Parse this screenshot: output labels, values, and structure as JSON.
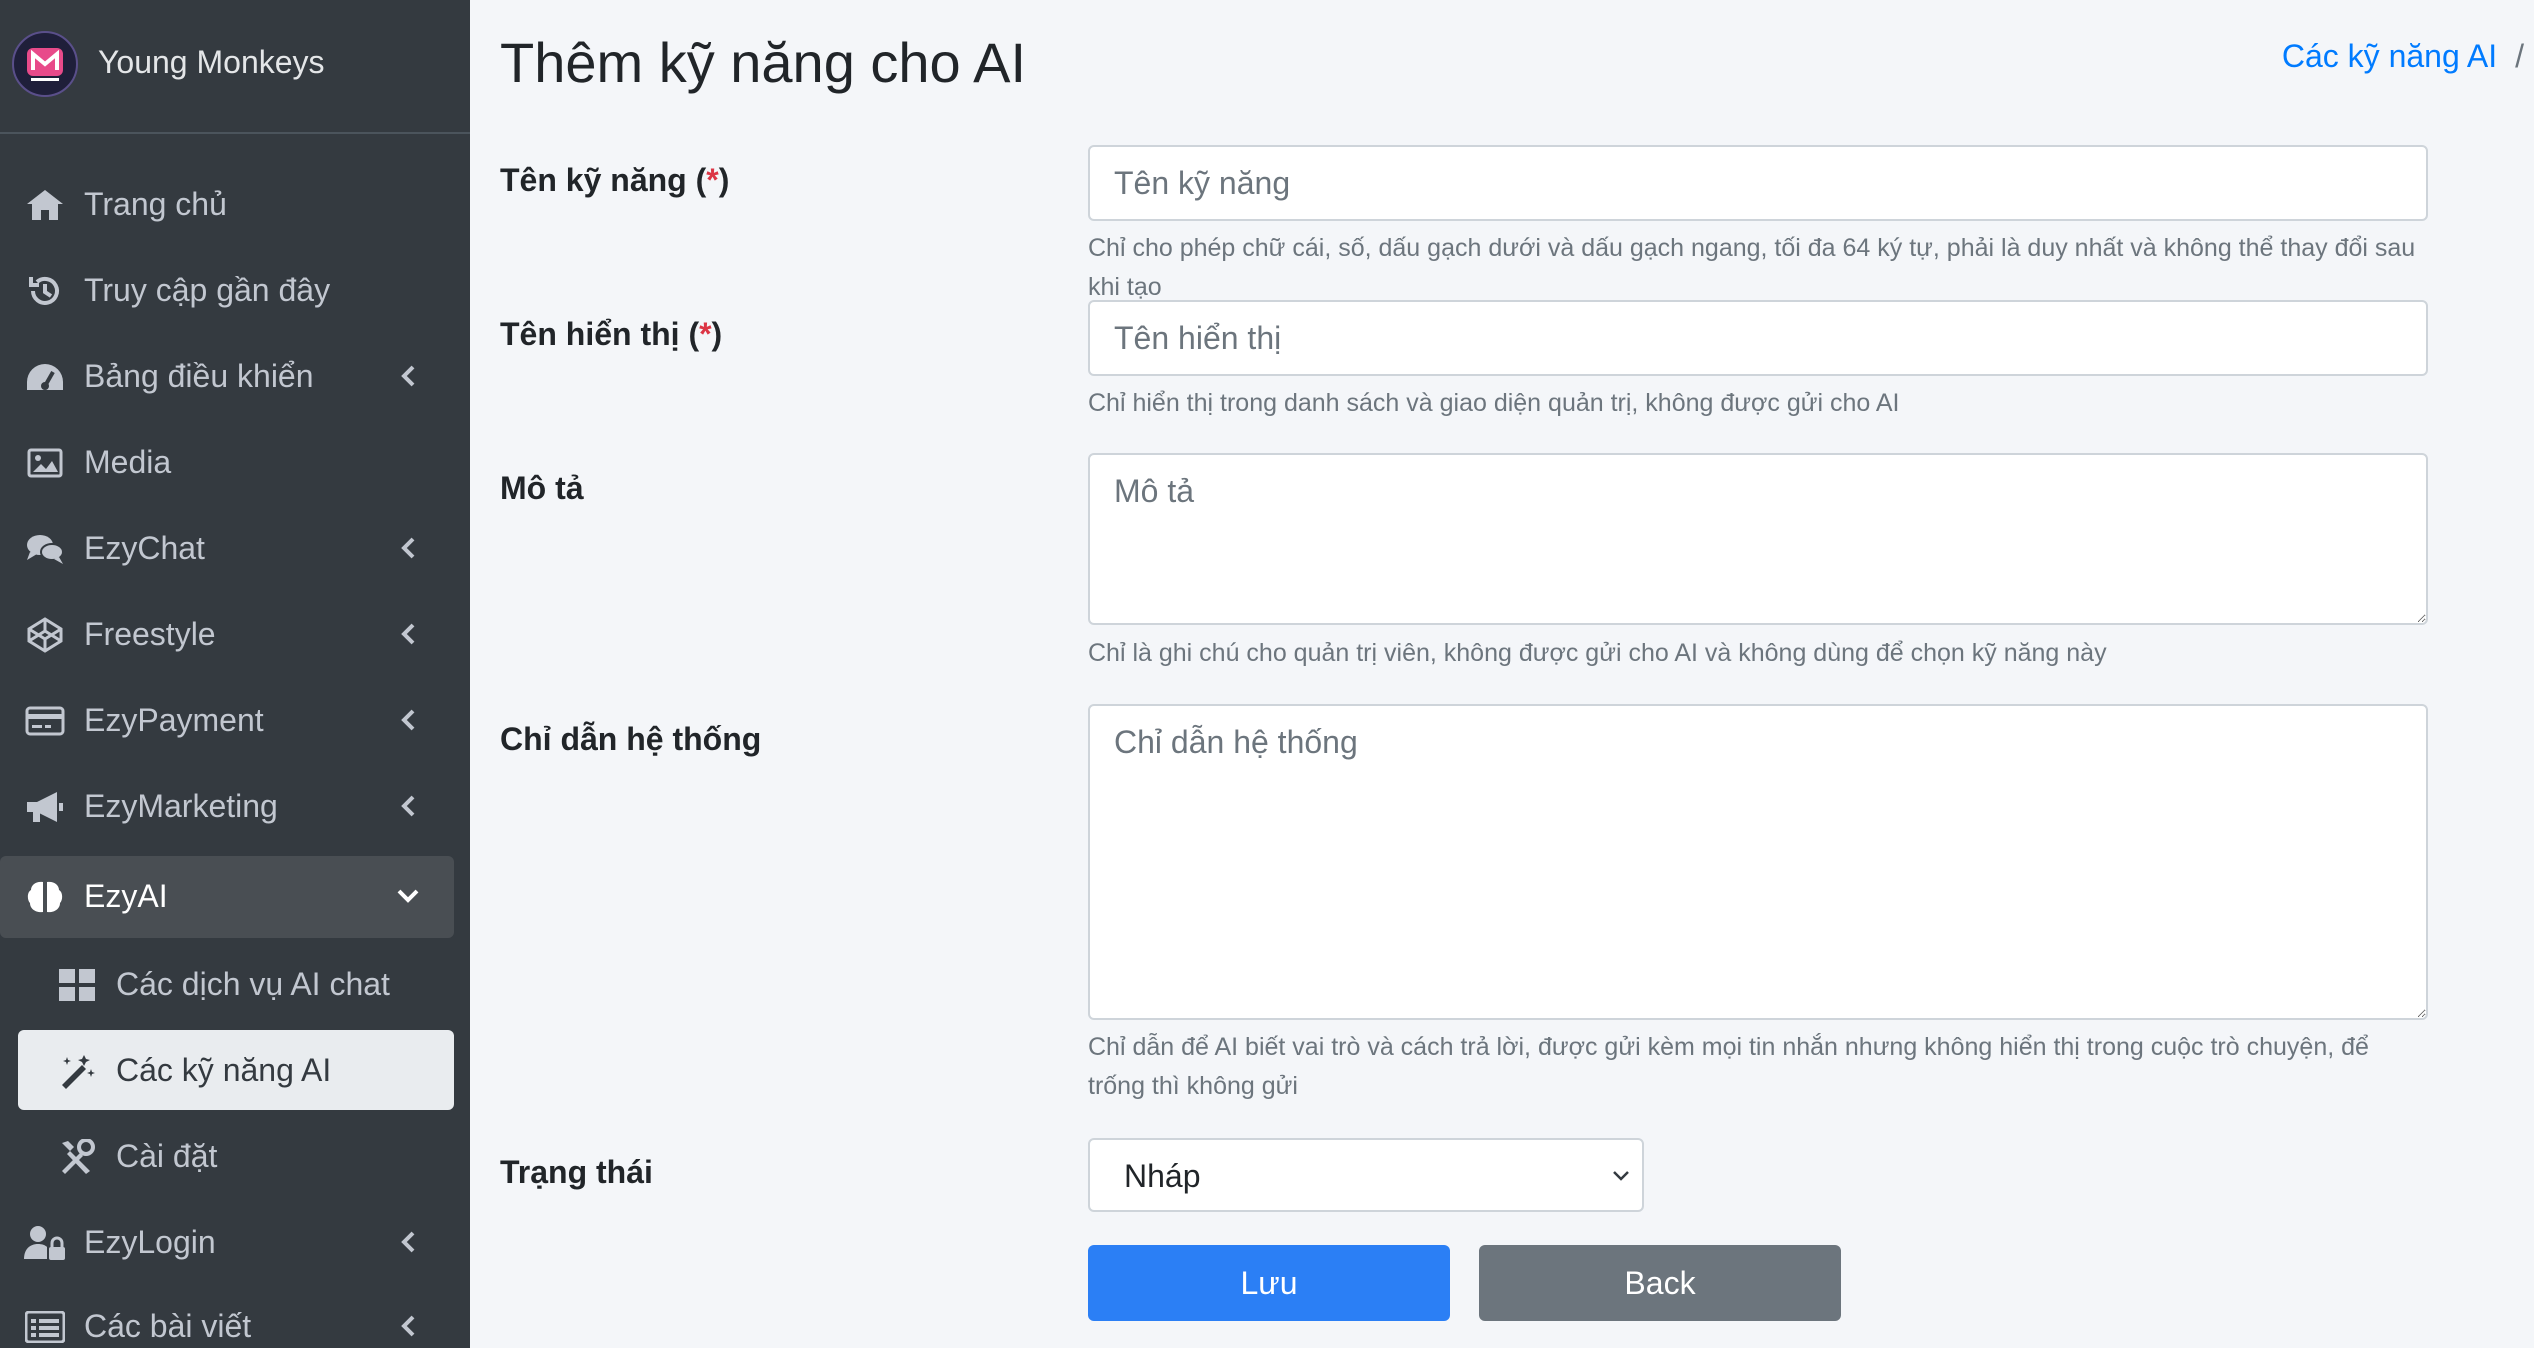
{
  "brand": {
    "name": "Young Monkeys",
    "logo_icon": "young-monkeys-logo"
  },
  "sidebar": {
    "items": [
      {
        "label": "Trang chủ",
        "icon": "home-icon",
        "has_arrow": false
      },
      {
        "label": "Truy cập gần đây",
        "icon": "history-icon",
        "has_arrow": false
      },
      {
        "label": "Bảng điều khiển",
        "icon": "dashboard-icon",
        "has_arrow": true
      },
      {
        "label": "Media",
        "icon": "image-icon",
        "has_arrow": false
      },
      {
        "label": "EzyChat",
        "icon": "chat-icon",
        "has_arrow": true
      },
      {
        "label": "Freestyle",
        "icon": "codepen-icon",
        "has_arrow": true
      },
      {
        "label": "EzyPayment",
        "icon": "credit-card-icon",
        "has_arrow": true
      },
      {
        "label": "EzyMarketing",
        "icon": "megaphone-icon",
        "has_arrow": true
      },
      {
        "label": "EzyAI",
        "icon": "brain-icon",
        "has_arrow": true,
        "open": true
      },
      {
        "label": "EzyLogin",
        "icon": "user-lock-icon",
        "has_arrow": true
      },
      {
        "label": "Các bài viết",
        "icon": "list-icon",
        "has_arrow": true
      }
    ],
    "subitems": [
      {
        "label": "Các dịch vụ AI chat",
        "icon": "grid-icon"
      },
      {
        "label": "Các kỹ năng AI",
        "icon": "magic-wand-icon",
        "active": true
      },
      {
        "label": "Cài đặt",
        "icon": "tools-icon"
      }
    ]
  },
  "page": {
    "title": "Thêm kỹ năng cho AI",
    "breadcrumb": {
      "link": "Các kỹ năng AI",
      "separator": "/"
    }
  },
  "form": {
    "skill_name": {
      "label": "Tên kỹ năng (",
      "req": "*",
      "label_end": ")",
      "placeholder": "Tên kỹ năng",
      "value": "",
      "help": "Chỉ cho phép chữ cái, số, dấu gạch dưới và dấu gạch ngang, tối đa 64 ký tự, phải là duy nhất và không thể thay đổi sau khi tạo"
    },
    "display_name": {
      "label": "Tên hiển thị (",
      "req": "*",
      "label_end": ")",
      "placeholder": "Tên hiển thị",
      "value": "",
      "help": "Chỉ hiển thị trong danh sách và giao diện quản trị, không được gửi cho AI"
    },
    "description": {
      "label": "Mô tả",
      "placeholder": "Mô tả",
      "value": "",
      "help": "Chỉ là ghi chú cho quản trị viên, không được gửi cho AI và không dùng để chọn kỹ năng này"
    },
    "system_prompt": {
      "label": "Chỉ dẫn hệ thống",
      "placeholder": "Chỉ dẫn hệ thống",
      "value": "",
      "help": "Chỉ dẫn để AI biết vai trò và cách trả lời, được gửi kèm mọi tin nhắn nhưng không hiển thị trong cuộc trò chuyện, để trống thì không gửi"
    },
    "status": {
      "label": "Trạng thái",
      "selected": "Nháp"
    },
    "save_label": "Lưu",
    "back_label": "Back"
  },
  "colors": {
    "sidebar_bg": "#343a40",
    "primary": "#2b7ff5",
    "secondary": "#6c757d",
    "required": "#dc3545",
    "link": "#007bff"
  }
}
